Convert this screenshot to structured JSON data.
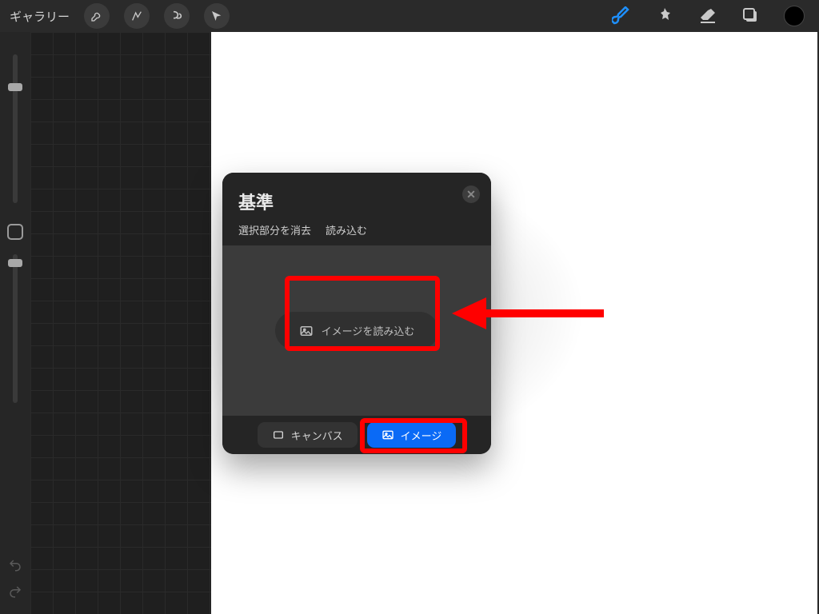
{
  "topbar": {
    "gallery_label": "ギャラリー"
  },
  "panel": {
    "title": "基準",
    "sub_clear": "選択部分を消去",
    "sub_load": "読み込む",
    "load_button": "イメージを読み込む",
    "tab_canvas": "キャンバス",
    "tab_image": "イメージ"
  },
  "annotation": {
    "color": "#ff0000"
  }
}
